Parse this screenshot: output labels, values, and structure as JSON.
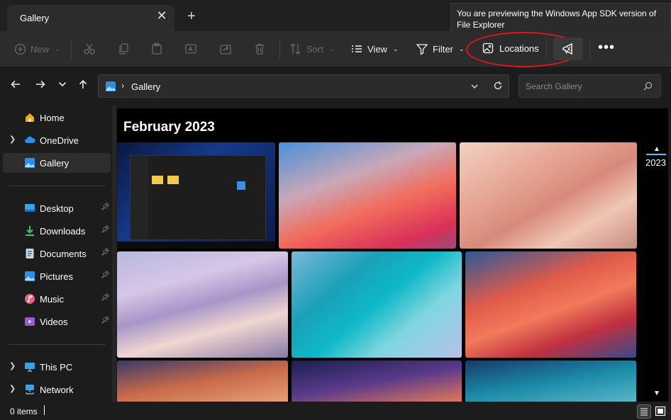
{
  "window": {
    "tab_title": "Gallery",
    "tab_close": "✕",
    "new_tab": "+",
    "tooltip": "You are previewing the Windows App SDK version of File Explorer"
  },
  "commandbar": {
    "new_label": "New",
    "sort_label": "Sort",
    "view_label": "View",
    "filter_label": "Filter",
    "locations_label": "Locations",
    "more_label": "•••"
  },
  "nav": {
    "address_location": "Gallery",
    "address_separator": "›",
    "search_placeholder": "Search Gallery"
  },
  "sidebar": {
    "items": [
      {
        "label": "Home",
        "icon": "home-icon"
      },
      {
        "label": "OneDrive",
        "icon": "cloud-icon"
      },
      {
        "label": "Gallery",
        "icon": "gallery-icon"
      },
      {
        "label": "Desktop",
        "icon": "desktop-icon"
      },
      {
        "label": "Downloads",
        "icon": "download-icon"
      },
      {
        "label": "Documents",
        "icon": "documents-icon"
      },
      {
        "label": "Pictures",
        "icon": "pictures-icon"
      },
      {
        "label": "Music",
        "icon": "music-icon"
      },
      {
        "label": "Videos",
        "icon": "videos-icon"
      },
      {
        "label": "This PC",
        "icon": "pc-icon"
      },
      {
        "label": "Network",
        "icon": "network-icon"
      }
    ]
  },
  "gallery": {
    "month_header": "February 2023",
    "year_marker": "2023"
  },
  "status": {
    "item_count": "0 items"
  },
  "colors": {
    "accent": "#4cc2ff",
    "annotation_oval": "#e0161a",
    "background": "#1c1c1c"
  }
}
